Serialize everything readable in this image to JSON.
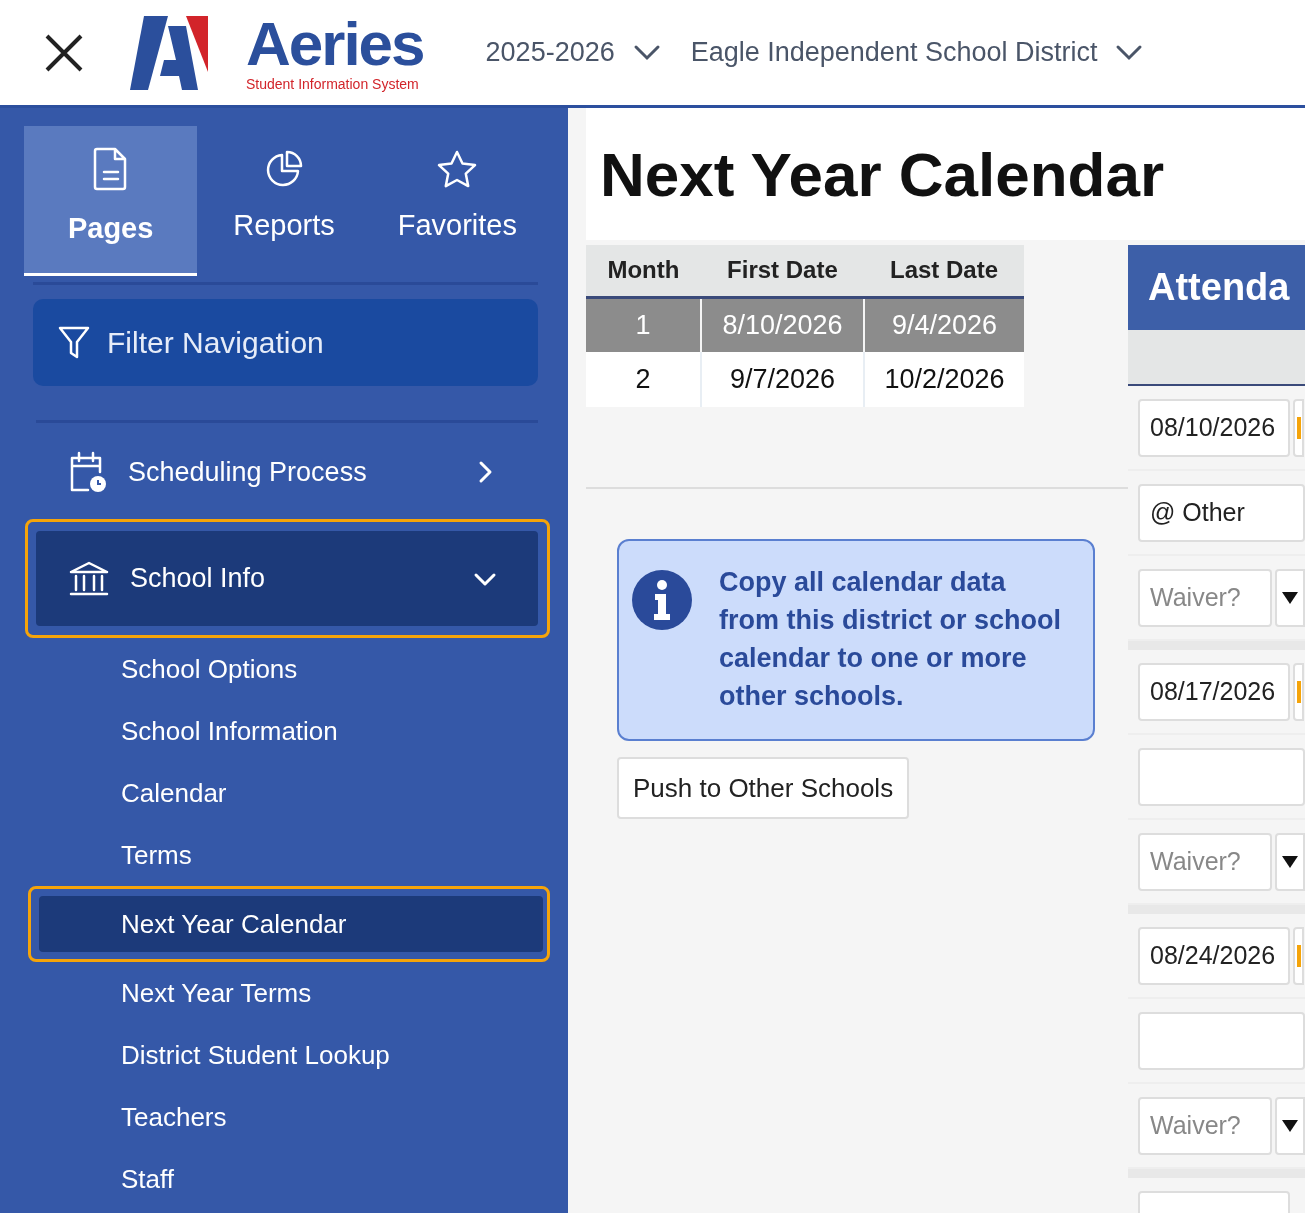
{
  "header": {
    "logo_text": "Aeries",
    "logo_tagline": "Student Information System",
    "year_select": "2025-2026",
    "district_select": "Eagle Independent School District"
  },
  "sidebar": {
    "tabs": [
      {
        "label": "Pages",
        "selected": true,
        "kind": "page"
      },
      {
        "label": "Reports",
        "selected": false,
        "kind": "chart"
      },
      {
        "label": "Favorites",
        "selected": false,
        "kind": "star"
      }
    ],
    "filter": {
      "placeholder": "Filter Navigation"
    },
    "items": [
      {
        "label": "Scheduling Process",
        "kind": "calendar",
        "expanded": false,
        "highlighted": false
      },
      {
        "label": "School Info",
        "kind": "building",
        "expanded": true,
        "highlighted": true,
        "children": [
          {
            "label": "School Options",
            "selected": false,
            "highlighted": false
          },
          {
            "label": "School Information",
            "selected": false,
            "highlighted": false
          },
          {
            "label": "Calendar",
            "selected": false,
            "highlighted": false
          },
          {
            "label": "Terms",
            "selected": false,
            "highlighted": false
          },
          {
            "label": "Next Year Calendar",
            "selected": true,
            "highlighted": true
          },
          {
            "label": "Next Year Terms",
            "selected": false,
            "highlighted": false
          },
          {
            "label": "District Student Lookup",
            "selected": false,
            "highlighted": false
          },
          {
            "label": "Teachers",
            "selected": false,
            "highlighted": false
          },
          {
            "label": "Staff",
            "selected": false,
            "highlighted": false
          }
        ]
      }
    ]
  },
  "page_title": "Next Year Calendar",
  "months_table": {
    "columns": [
      "Month",
      "First Date",
      "Last Date"
    ],
    "rows": [
      {
        "cells": [
          "1",
          "8/10/2026",
          "9/4/2026"
        ],
        "selected": true
      },
      {
        "cells": [
          "2",
          "9/7/2026",
          "10/2/2026"
        ],
        "selected": false
      }
    ]
  },
  "info": {
    "text": "Copy all calendar data from this district or school calendar to one or more other schools."
  },
  "push_button": "Push to Other Schools",
  "attendance": {
    "title": "Attenda",
    "days": [
      {
        "date": "08/10/2026",
        "note": "@ Other",
        "waiver_placeholder": "Waiver?"
      },
      {
        "date": "08/17/2026",
        "waiver_placeholder": "Waiver?"
      },
      {
        "date": "08/24/2026",
        "waiver_placeholder": "Waiver?"
      }
    ]
  }
}
